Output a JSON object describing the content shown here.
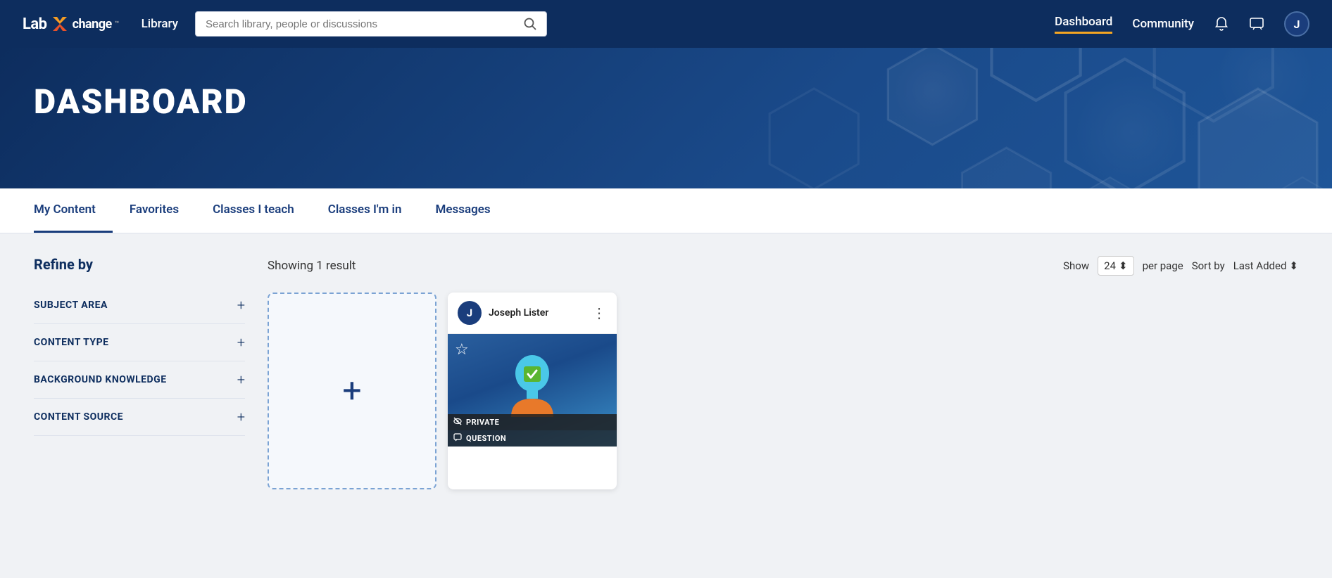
{
  "brand": {
    "lab": "Lab",
    "x_label": "X",
    "change": "change",
    "tm": "™"
  },
  "navbar": {
    "library_label": "Library",
    "search_placeholder": "Search library, people or discussions",
    "dashboard_label": "Dashboard",
    "community_label": "Community",
    "user_initial": "J"
  },
  "hero": {
    "title": "DASHBOARD"
  },
  "tabs": [
    {
      "id": "my-content",
      "label": "My Content",
      "active": true
    },
    {
      "id": "favorites",
      "label": "Favorites",
      "active": false
    },
    {
      "id": "classes-i-teach",
      "label": "Classes I teach",
      "active": false
    },
    {
      "id": "classes-im-in",
      "label": "Classes I'm in",
      "active": false
    },
    {
      "id": "messages",
      "label": "Messages",
      "active": false
    }
  ],
  "sidebar": {
    "refine_label": "Refine by",
    "filters": [
      {
        "id": "subject-area",
        "label": "SUBJECT AREA"
      },
      {
        "id": "content-type",
        "label": "CONTENT TYPE"
      },
      {
        "id": "background-knowledge",
        "label": "BACKGROUND KNOWLEDGE"
      },
      {
        "id": "content-source",
        "label": "CONTENT SOURCE"
      }
    ]
  },
  "results": {
    "showing_text": "Showing 1 result",
    "show_label": "Show",
    "show_value": "24",
    "per_page_label": "per page",
    "sort_by_label": "Sort by",
    "sort_value": "Last Added"
  },
  "add_card": {
    "plus_symbol": "+"
  },
  "content_card": {
    "author_initial": "J",
    "author_name": "Joseph Lister",
    "menu_dots": "⋮",
    "star": "☆",
    "badge_private": "PRIVATE",
    "badge_question": "QUESTION",
    "badge_private_icon": "🚫",
    "badge_question_icon": "💬"
  }
}
